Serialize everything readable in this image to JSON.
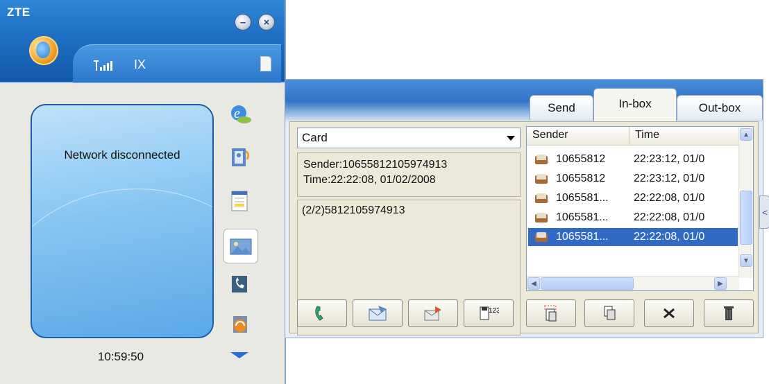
{
  "app": {
    "brand": "ZTE",
    "network_type": "IX",
    "signal_icon": "signal-bars",
    "network_status": "Network disconnected",
    "clock": "10:59:50"
  },
  "tabs": [
    {
      "label": "Send"
    },
    {
      "label": "In-box"
    },
    {
      "label": "Out-box"
    }
  ],
  "message": {
    "folder": "Card",
    "sender_line": "Sender:10655812105974913",
    "time_line": "Time:22:22:08, 01/02/2008",
    "body": "(2/2)5812105974913"
  },
  "list": {
    "columns": [
      "Sender",
      "Time"
    ],
    "rows": [
      {
        "sender": "10655812",
        "time": "22:23:12, 01/0"
      },
      {
        "sender": "10655812",
        "time": "22:23:12, 01/0"
      },
      {
        "sender": "1065581...",
        "time": "22:22:08, 01/0"
      },
      {
        "sender": "1065581...",
        "time": "22:22:08, 01/0"
      },
      {
        "sender": "1065581...",
        "time": "22:22:08, 01/0"
      }
    ]
  },
  "toolbar": {
    "save_label": "123"
  },
  "colors": {
    "titlebar": "#1e6fc4",
    "selection": "#316ac5",
    "panel_bg": "#ece9d8"
  }
}
